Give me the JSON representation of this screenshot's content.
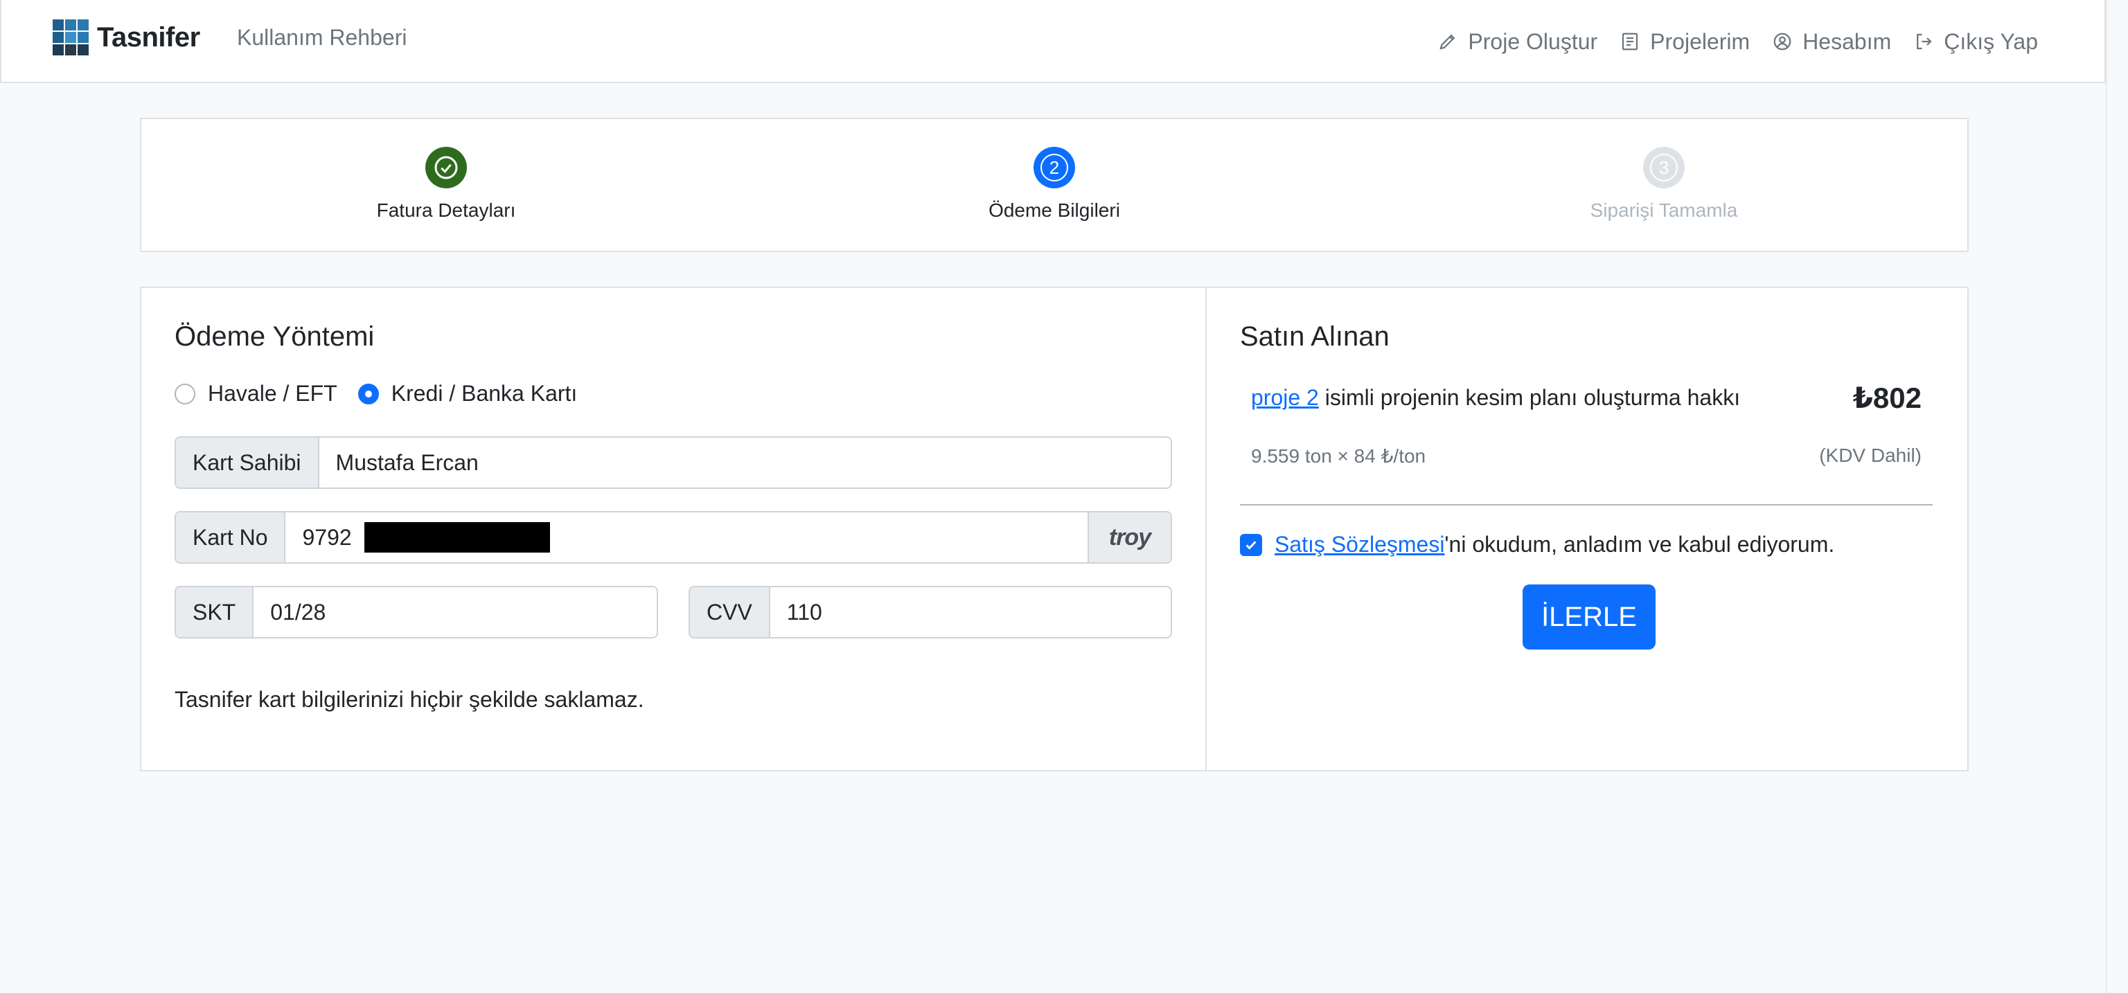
{
  "navbar": {
    "brand": "Tasnifer",
    "guide": "Kullanım Rehberi",
    "items": [
      {
        "label": "Proje Oluştur",
        "icon": "pencil-icon"
      },
      {
        "label": "Projelerim",
        "icon": "document-icon"
      },
      {
        "label": "Hesabım",
        "icon": "user-circle-icon"
      },
      {
        "label": "Çıkış Yap",
        "icon": "logout-icon"
      }
    ]
  },
  "steps": [
    {
      "label": "Fatura Detayları",
      "state": "done",
      "color": "#2e6b1f"
    },
    {
      "number": "2",
      "label": "Ödeme Bilgileri",
      "state": "active",
      "color": "#0d6efd"
    },
    {
      "number": "3",
      "label": "Siparişi Tamamla",
      "state": "pending",
      "color": "#dee2e6"
    }
  ],
  "payment": {
    "title": "Ödeme Yöntemi",
    "methods": [
      {
        "label": "Havale / EFT",
        "selected": false
      },
      {
        "label": "Kredi / Banka Kartı",
        "selected": true
      }
    ],
    "card_holder_label": "Kart Sahibi",
    "card_holder_value": "Mustafa Ercan",
    "card_no_label": "Kart No",
    "card_no_value": "9792",
    "card_brand": "troy",
    "expiry_label": "SKT",
    "expiry_value": "01/28",
    "cvv_label": "CVV",
    "cvv_value": "110",
    "notice": "Tasnifer kart bilgilerinizi hiçbir şekilde saklamaz."
  },
  "summary": {
    "title": "Satın Alınan",
    "project_link": "proje 2",
    "description": " isimli projenin kesim planı oluşturma hakkı",
    "price": "₺802",
    "calculation": "9.559 ton × 84 ₺/ton",
    "tax_note": "(KDV Dahil)",
    "agreement_link": "Satış Sözleşmesi",
    "agreement_text": "'ni okudum, anladım ve kabul ediyorum.",
    "agreement_checked": true,
    "next_button": "İLERLE"
  },
  "colors": {
    "primary": "#0d6efd",
    "success": "#2e6b1f",
    "muted": "#6c757d"
  }
}
